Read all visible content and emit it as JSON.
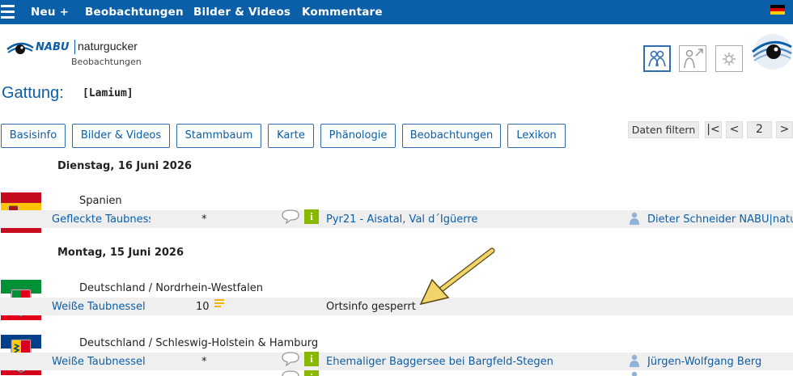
{
  "nav": {
    "items": [
      "Neu +",
      "Bebachtungen",
      "Bilder & Videos",
      "Kommentare"
    ]
  },
  "logo": {
    "brand": "NABU",
    "name": "naturgucker",
    "subtitle": "Beobachtungen"
  },
  "gattung": {
    "label": "Gattung:",
    "value": "[Lamium]"
  },
  "tabs": [
    "Basisinfo",
    "Bilder & Videos",
    "Stammbaum",
    "Karte",
    "Phänologie",
    "Beobachtungen",
    "Lexikon"
  ],
  "controls": {
    "filter": "Daten filtern",
    "first": "|<",
    "prev": "<",
    "page": "2",
    "next": ">"
  },
  "groups": [
    {
      "date": "Dienstag, 16 Juni 2026",
      "entries": [
        {
          "region": "Spanien",
          "species": "Gefleckte Taubnessel",
          "count": "*",
          "place": "Pyr21 - Aisatal, Val d´Igüerre",
          "observer": "Dieter Schneider NABU|naturgucker"
        }
      ]
    },
    {
      "date": "Montag, 15 Juni 2026",
      "entries": [
        {
          "region": "Deutschland / Nordrhein-Westfalen",
          "species": "Weiße Taubnessel",
          "count": "10",
          "place": "Ortsinfo gesperrt",
          "observer": ""
        },
        {
          "region": "Deutschland / Schleswig-Holstein & Hamburg",
          "species": "Weiße Taubnessel",
          "count": "*",
          "place": "Ehemaliger Baggersee bei Bargfeld-Stegen",
          "observer": "Jürgen-Wolfgang Berg"
        }
      ]
    }
  ],
  "colors": {
    "nav": "#0b5ea8",
    "link": "#0b5ea8",
    "row": "#efefef",
    "info": "#8ab700",
    "arrow": "#f2d46a"
  }
}
